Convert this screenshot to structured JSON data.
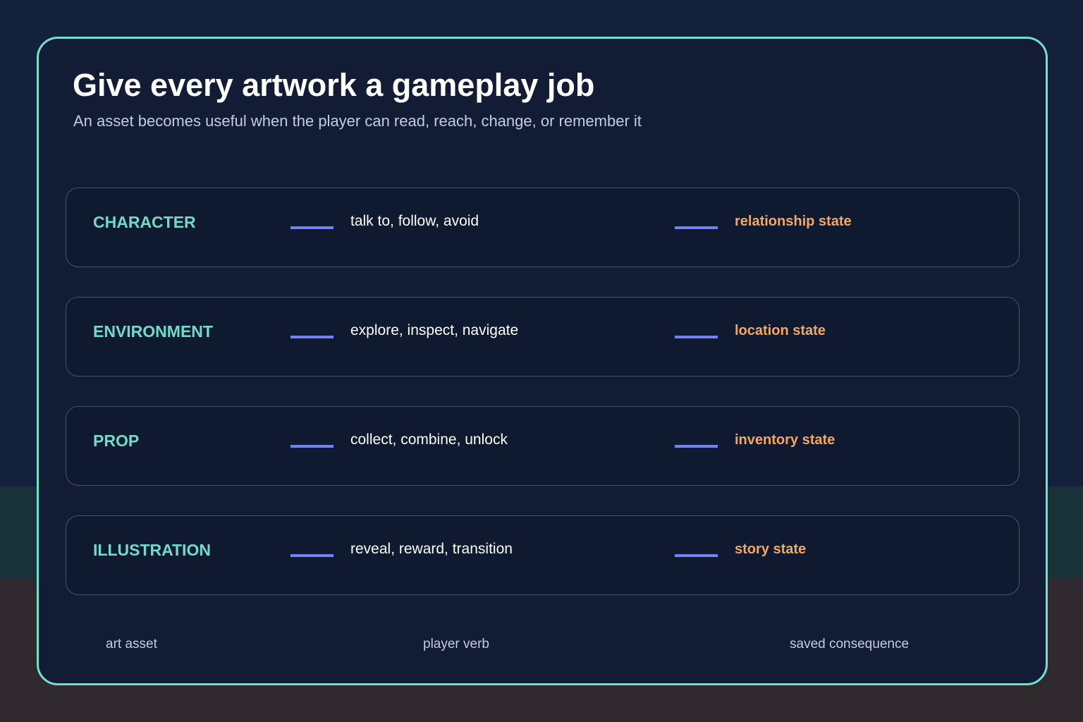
{
  "colors": {
    "background": "#13213c",
    "band_mid": "#193239",
    "band_bottom": "#302a2f",
    "card_border": "#72e1cc",
    "card_fill": "#121d35",
    "row_border": "#43546f",
    "asset_text": "#6fdbc8",
    "connector": "#7183f5",
    "consequence_text": "#f3a760"
  },
  "title": "Give every artwork a gameplay job",
  "subtitle": "An asset becomes useful when the player can read, reach, change, or remember it",
  "rows": [
    {
      "asset": "CHARACTER",
      "verb": "talk to, follow, avoid",
      "consequence": "relationship state"
    },
    {
      "asset": "ENVIRONMENT",
      "verb": "explore, inspect, navigate",
      "consequence": "location state"
    },
    {
      "asset": "PROP",
      "verb": "collect, combine, unlock",
      "consequence": "inventory state"
    },
    {
      "asset": "ILLUSTRATION",
      "verb": "reveal, reward, transition",
      "consequence": "story state"
    }
  ],
  "footer": {
    "asset_label": "art asset",
    "verb_label": "player verb",
    "consequence_label": "saved consequence"
  }
}
